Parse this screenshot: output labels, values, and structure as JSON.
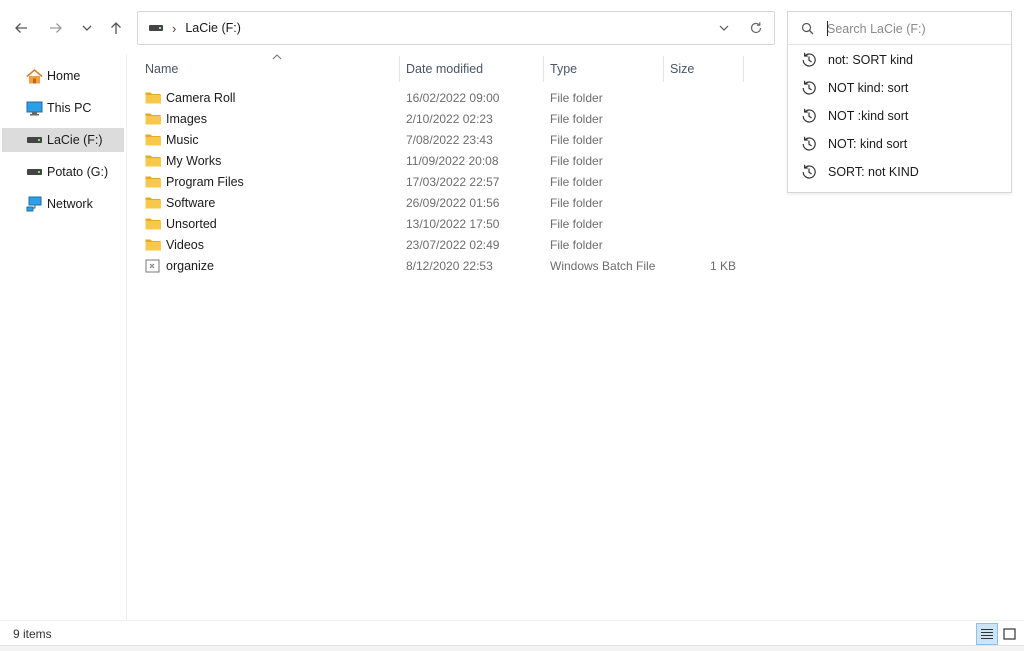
{
  "address": {
    "separator": "›",
    "path": "LaCie (F:)"
  },
  "search": {
    "placeholder": "Search LaCie (F:)",
    "value": "",
    "history": [
      "not: SORT kind",
      "NOT kind: sort",
      "NOT :kind sort",
      "NOT: kind sort",
      "SORT: not KIND"
    ]
  },
  "sidebar": {
    "items": [
      {
        "label": "Home",
        "icon": "home-icon"
      },
      {
        "label": "This PC",
        "icon": "monitor-icon"
      },
      {
        "label": "LaCie (F:)",
        "icon": "drive-icon",
        "selected": true
      },
      {
        "label": "Potato (G:)",
        "icon": "drive-icon"
      },
      {
        "label": "Network",
        "icon": "network-icon"
      }
    ]
  },
  "columns": {
    "name": "Name",
    "date": "Date modified",
    "type": "Type",
    "size": "Size"
  },
  "files": [
    {
      "name": "Camera Roll",
      "date": "16/02/2022 09:00",
      "type": "File folder",
      "size": "",
      "icon": "folder-icon"
    },
    {
      "name": "Images",
      "date": "2/10/2022 02:23",
      "type": "File folder",
      "size": "",
      "icon": "folder-icon"
    },
    {
      "name": "Music",
      "date": "7/08/2022 23:43",
      "type": "File folder",
      "size": "",
      "icon": "folder-icon"
    },
    {
      "name": "My Works",
      "date": "11/09/2022 20:08",
      "type": "File folder",
      "size": "",
      "icon": "folder-icon"
    },
    {
      "name": "Program Files",
      "date": "17/03/2022 22:57",
      "type": "File folder",
      "size": "",
      "icon": "folder-icon"
    },
    {
      "name": "Software",
      "date": "26/09/2022 01:56",
      "type": "File folder",
      "size": "",
      "icon": "folder-icon"
    },
    {
      "name": "Unsorted",
      "date": "13/10/2022 17:50",
      "type": "File folder",
      "size": "",
      "icon": "folder-icon"
    },
    {
      "name": "Videos",
      "date": "23/07/2022 02:49",
      "type": "File folder",
      "size": "",
      "icon": "folder-icon"
    },
    {
      "name": "organize",
      "date": "8/12/2020 22:53",
      "type": "Windows Batch File",
      "size": "1 KB",
      "icon": "batch-file-icon"
    }
  ],
  "status": {
    "item_count": "9 items"
  },
  "colors": {
    "folder": "#f8c84a",
    "selection": "#dcdcdc",
    "view_active": "#cce4f7"
  }
}
